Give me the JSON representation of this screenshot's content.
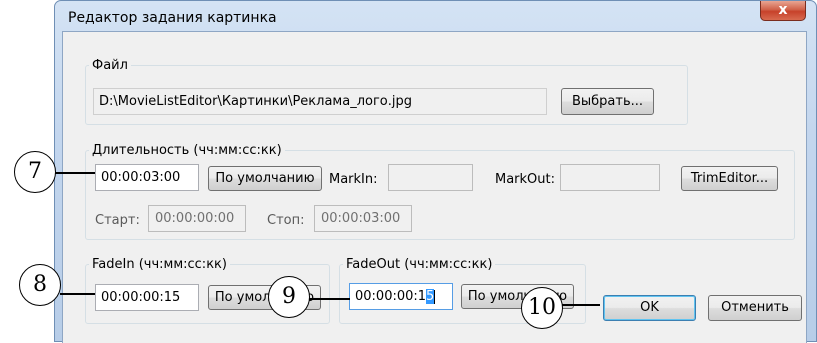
{
  "window": {
    "title": "Редактор задания картинка",
    "close_glyph": "x"
  },
  "file_group": {
    "label": "Файл",
    "path": "D:\\MovieListEditor\\Картинки\\Реклама_лого.jpg",
    "browse_button": "Выбрать..."
  },
  "duration_group": {
    "label": "Длительность (чч:мм:сс:кк)",
    "value": "00:00:03:00",
    "default_button": "По умолчанию",
    "markin_label": "MarkIn:",
    "markin_value": "",
    "markout_label": "MarkOut:",
    "markout_value": "",
    "trim_button": "TrimEditor...",
    "start_label": "Старт:",
    "start_value": "00:00:00:00",
    "stop_label": "Стоп:",
    "stop_value": "00:00:03:00"
  },
  "fadein_group": {
    "label": "FadeIn (чч:мм:сс:кк)",
    "value": "00:00:00:15",
    "default_button": "По умолчанию"
  },
  "fadeout_group": {
    "label": "FadeOut (чч:мм:сс:кк)",
    "value_prefix": "00:00:00:1",
    "value_selected": "5",
    "default_button": "По умолчанию"
  },
  "dialog_buttons": {
    "ok": "OK",
    "cancel": "Отменить"
  },
  "callouts": {
    "c7": "7",
    "c8": "8",
    "c9": "9",
    "c10": "10"
  }
}
